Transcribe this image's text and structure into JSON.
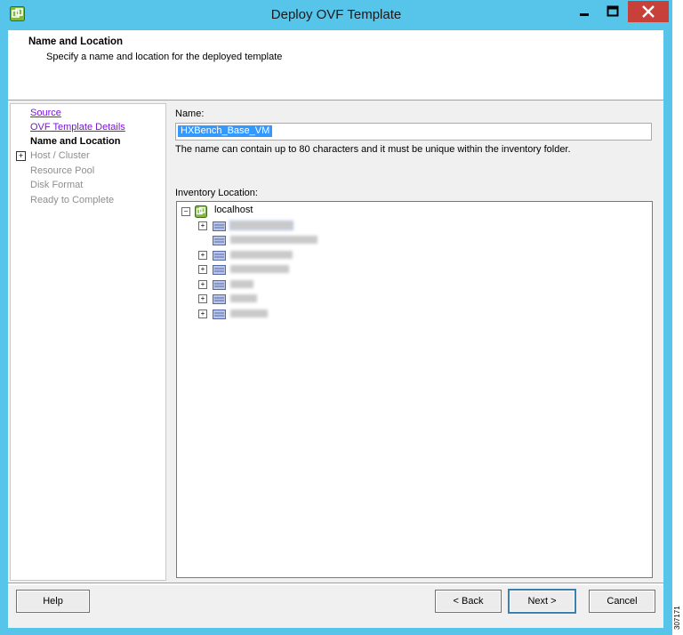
{
  "window": {
    "title": "Deploy OVF Template",
    "accent_color": "#57c5ea",
    "close_color": "#c7413a",
    "icons": {
      "app": "vsphere-logo-icon",
      "minimize": "minimize-icon",
      "maximize": "maximize-icon",
      "close": "close-icon"
    }
  },
  "header": {
    "title": "Name and Location",
    "subtitle": "Specify a name and location for the deployed template"
  },
  "steps": [
    {
      "label": "Source",
      "state": "link"
    },
    {
      "label": "OVF Template Details",
      "state": "link"
    },
    {
      "label": "Name and Location",
      "state": "current"
    },
    {
      "label": "Host / Cluster",
      "state": "disabled"
    },
    {
      "label": "Resource Pool",
      "state": "disabled"
    },
    {
      "label": "Disk Format",
      "state": "disabled"
    },
    {
      "label": "Ready to Complete",
      "state": "disabled"
    }
  ],
  "form": {
    "name_label": "Name:",
    "name_value": "HXBench_Base_VM",
    "name_hint": "The name can contain up to 80 characters and it must be unique within the inventory folder.",
    "inventory_label": "Inventory Location:"
  },
  "tree": {
    "root": "localhost",
    "root_icon": "host-icon",
    "child_icon": "datacenter-folder-icon"
  },
  "buttons": {
    "help": "Help",
    "back": "< Back",
    "next": "Next >",
    "cancel": "Cancel"
  },
  "figure_id": "307171"
}
